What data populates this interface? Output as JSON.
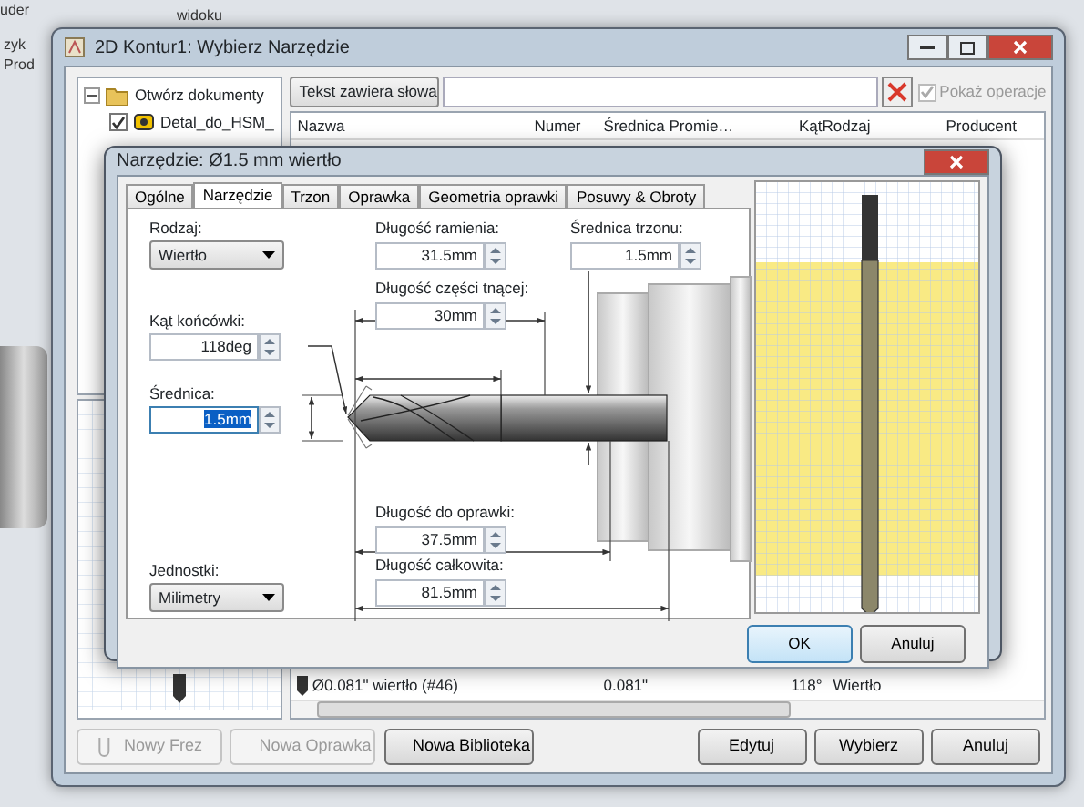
{
  "background_app": {
    "texts": [
      "uder",
      "widoku",
      "zyk",
      "Prod"
    ]
  },
  "window": {
    "title": "2D Kontur1: Wybierz Narzędzie"
  },
  "tree": [
    {
      "label": "Otwórz dokumenty",
      "expanded": true,
      "children": [
        {
          "label": "Detal_do_HSM_",
          "checked": true
        }
      ]
    }
  ],
  "filter": {
    "mode": "Tekst zawiera słowa",
    "show_operations": {
      "label": "Pokaż operacje",
      "checked": true,
      "disabled": true
    }
  },
  "table": {
    "columns": [
      "Nazwa",
      "Numer",
      "Średnica",
      "Promie…",
      "Kąt",
      "Rodzaj",
      "Producent"
    ],
    "rows": [
      {
        "name": "Ø0.081\" wiertło (#46)",
        "diameter": "0.081\"",
        "angle": "118°",
        "type": "Wiertło"
      }
    ]
  },
  "left_buttons": [
    {
      "label": "Nowy Frez",
      "disabled": true
    },
    {
      "label": "Nowa Oprawka",
      "disabled": true
    },
    {
      "label": "Nowa Biblioteka",
      "disabled": false
    }
  ],
  "right_buttons": [
    {
      "label": "Edytuj"
    },
    {
      "label": "Wybierz"
    },
    {
      "label": "Anuluj"
    }
  ],
  "tool_dialog": {
    "title": "Narzędzie: Ø1.5 mm wiertło",
    "tabs": [
      {
        "label": "Ogólne",
        "selected": false
      },
      {
        "label": "Narzędzie",
        "selected": true
      },
      {
        "label": "Trzon",
        "selected": false
      },
      {
        "label": "Oprawka",
        "selected": false
      },
      {
        "label": "Geometria oprawki",
        "selected": false
      },
      {
        "label": "Posuwy & Obroty",
        "selected": false
      }
    ],
    "fields": [
      {
        "label": "Rodzaj:",
        "kind": "select",
        "value": "Wiertło"
      },
      {
        "label": "Kąt końcówki:",
        "kind": "spin",
        "value": "118deg",
        "focused": false
      },
      {
        "label": "Średnica:",
        "kind": "spin",
        "value": "1.5mm",
        "focused": true
      },
      {
        "label": "Jednostki:",
        "kind": "select",
        "value": "Milimetry"
      },
      {
        "label": "Długość ramienia:",
        "kind": "spin",
        "value": "31.5mm",
        "focused": false
      },
      {
        "label": "Długość części tnącej:",
        "kind": "spin",
        "value": "30mm",
        "focused": false
      },
      {
        "label": "Średnica trzonu:",
        "kind": "spin",
        "value": "1.5mm",
        "focused": false
      },
      {
        "label": "Długość do oprawki:",
        "kind": "spin",
        "value": "37.5mm",
        "focused": false
      },
      {
        "label": "Długość całkowita:",
        "kind": "spin",
        "value": "81.5mm",
        "focused": false
      }
    ],
    "buttons": [
      {
        "label": "OK",
        "default": true
      },
      {
        "label": "Anuluj",
        "default": false
      }
    ]
  }
}
